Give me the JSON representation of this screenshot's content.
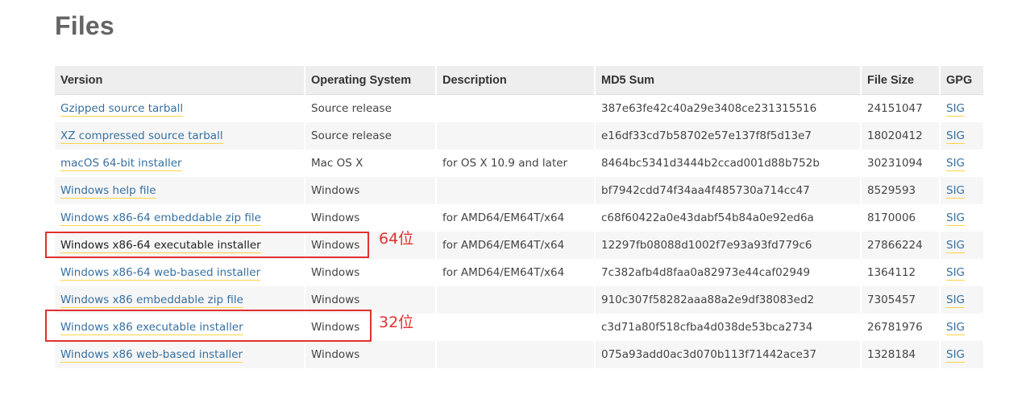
{
  "page": {
    "title": "Files"
  },
  "table": {
    "headers": [
      "Version",
      "Operating System",
      "Description",
      "MD5 Sum",
      "File Size",
      "GPG"
    ],
    "rows": [
      {
        "version": "Gzipped source tarball",
        "os": "Source release",
        "description": "",
        "md5": "387e63fe42c40a29e3408ce231315516",
        "size": "24151047",
        "gpg": "SIG"
      },
      {
        "version": "XZ compressed source tarball",
        "os": "Source release",
        "description": "",
        "md5": "e16df33cd7b58702e57e137f8f5d13e7",
        "size": "18020412",
        "gpg": "SIG"
      },
      {
        "version": "macOS 64-bit installer",
        "os": "Mac OS X",
        "description": "for OS X 10.9 and later",
        "md5": "8464bc5341d3444b2ccad001d88b752b",
        "size": "30231094",
        "gpg": "SIG"
      },
      {
        "version": "Windows help file",
        "os": "Windows",
        "description": "",
        "md5": "bf7942cdd74f34aa4f485730a714cc47",
        "size": "8529593",
        "gpg": "SIG"
      },
      {
        "version": "Windows x86-64 embeddable zip file",
        "os": "Windows",
        "description": "for AMD64/EM64T/x64",
        "md5": "c68f60422a0e43dabf54b84a0e92ed6a",
        "size": "8170006",
        "gpg": "SIG"
      },
      {
        "version": "Windows x86-64 executable installer",
        "os": "Windows",
        "description": "for AMD64/EM64T/x64",
        "md5": "12297fb08088d1002f7e93a93fd779c6",
        "size": "27866224",
        "gpg": "SIG"
      },
      {
        "version": "Windows x86-64 web-based installer",
        "os": "Windows",
        "description": "for AMD64/EM64T/x64",
        "md5": "7c382afb4d8faa0a82973e44caf02949",
        "size": "1364112",
        "gpg": "SIG"
      },
      {
        "version": "Windows x86 embeddable zip file",
        "os": "Windows",
        "description": "",
        "md5": "910c307f58282aaa88a2e9df38083ed2",
        "size": "7305457",
        "gpg": "SIG"
      },
      {
        "version": "Windows x86 executable installer",
        "os": "Windows",
        "description": "",
        "md5": "c3d71a80f518cfba4d038de53bca2734",
        "size": "26781976",
        "gpg": "SIG"
      },
      {
        "version": "Windows x86 web-based installer",
        "os": "Windows",
        "description": "",
        "md5": "075a93add0ac3d070b113f71442ace37",
        "size": "1328184",
        "gpg": "SIG"
      }
    ]
  },
  "annotations": {
    "label_64": "64位",
    "label_32": "32位"
  },
  "colors": {
    "link": "#3670a0",
    "link_underline": "#ffd343",
    "annotation": "#e0322f",
    "header_bg": "#eeeeee"
  }
}
